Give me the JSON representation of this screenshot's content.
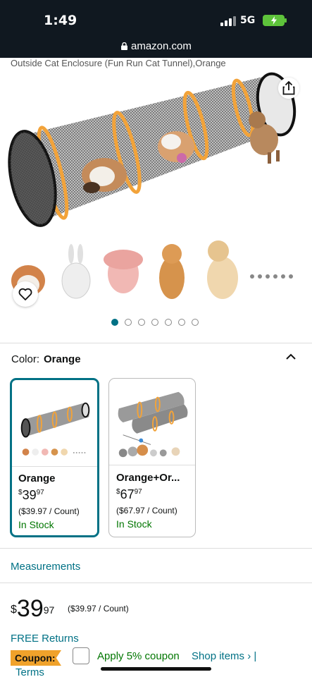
{
  "status_bar": {
    "time": "1:49",
    "network": "5G"
  },
  "browser": {
    "url": "amazon.com"
  },
  "product": {
    "title_fragment": "Outside Cat Enclosure (Fun Run Cat Tunnel),Orange"
  },
  "gallery": {
    "image_count": 7,
    "active_index": 0
  },
  "color_selector": {
    "label": "Color:",
    "value": "Orange"
  },
  "variants": [
    {
      "name": "Orange",
      "price_whole": "39",
      "price_fraction": "97",
      "currency": "$",
      "unit_price": "($39.97 / Count)",
      "stock": "In Stock",
      "selected": true
    },
    {
      "name": "Orange+Or...",
      "price_whole": "67",
      "price_fraction": "97",
      "currency": "$",
      "unit_price": "($67.97 / Count)",
      "stock": "In Stock",
      "selected": false
    }
  ],
  "measurements_link": "Measurements",
  "price": {
    "currency": "$",
    "whole": "39",
    "fraction": "97",
    "unit_price": "($39.97 / Count)"
  },
  "free_returns": "FREE Returns",
  "coupon": {
    "badge": "Coupon:",
    "apply_text": "Apply 5% coupon",
    "shop_items": "Shop items › |",
    "terms": "Terms"
  },
  "colors": {
    "link": "#007185",
    "stock_green": "#007600",
    "coupon_orange": "#f0a22b",
    "tunnel_orange": "#f2a33a",
    "status_bg": "#101820"
  }
}
